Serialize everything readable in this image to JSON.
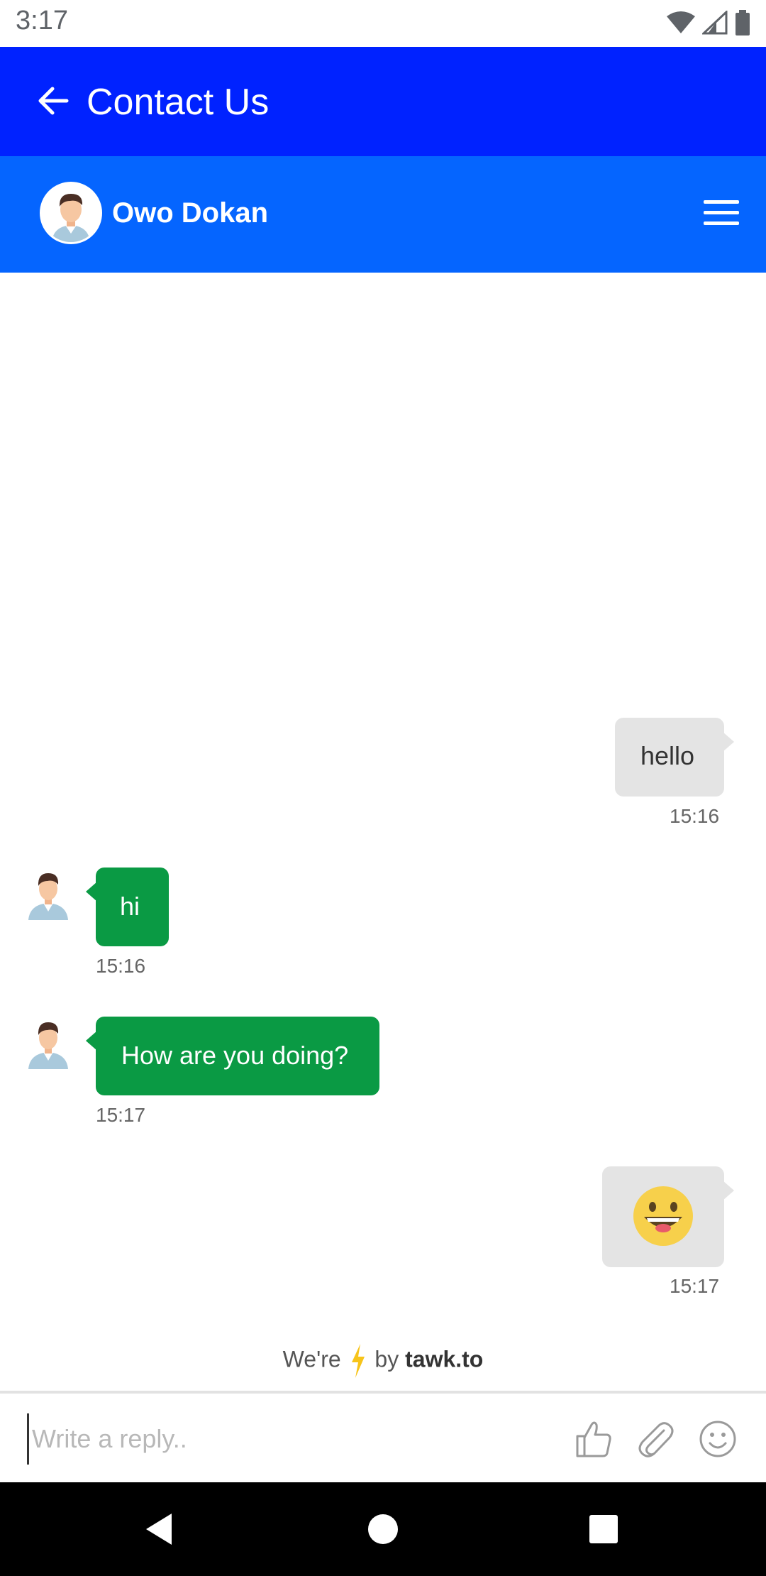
{
  "status_bar": {
    "time": "3:17",
    "icons": [
      "wifi-icon",
      "signal-icon",
      "battery-icon"
    ]
  },
  "app_bar": {
    "title": "Contact Us",
    "back_icon": "arrow-left-icon",
    "background": "#0022ff"
  },
  "chat_header": {
    "agent_name": "Owo Dokan",
    "menu_icon": "hamburger-menu-icon",
    "background": "#0565ff"
  },
  "messages": [
    {
      "direction": "outgoing",
      "text": "hello",
      "time": "15:16"
    },
    {
      "direction": "incoming",
      "text": "hi",
      "time": "15:16"
    },
    {
      "direction": "incoming",
      "text": "How are you doing?",
      "time": "15:17"
    },
    {
      "direction": "outgoing",
      "emoji": "grinning-face-emoji",
      "time": "15:17"
    }
  ],
  "branding": {
    "prefix": "We're",
    "icon": "lightning-bolt-icon",
    "by": "by",
    "brand": "tawk.to"
  },
  "composer": {
    "placeholder": "Write a reply..",
    "icons": [
      "thumbs-up-icon",
      "paperclip-icon",
      "smiley-icon"
    ]
  },
  "colors": {
    "incoming_bubble": "#0a9a44",
    "outgoing_bubble": "#e4e4e4"
  },
  "nav_bar": {
    "buttons": [
      "back-triangle-icon",
      "home-circle-icon",
      "recents-square-icon"
    ]
  }
}
